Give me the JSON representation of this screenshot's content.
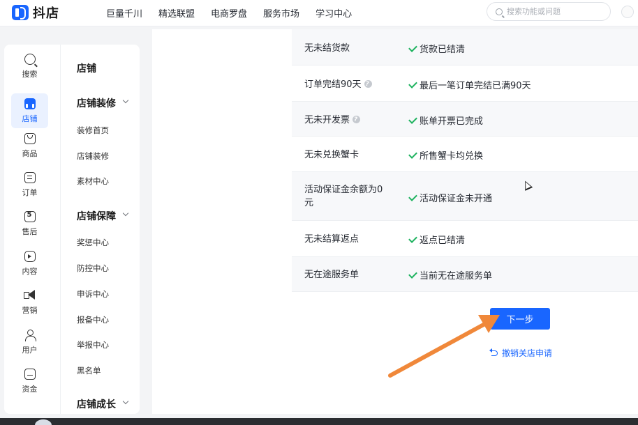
{
  "app": {
    "logo_text": "抖店",
    "brand_color": "#1966ff"
  },
  "topnav": [
    "巨量千川",
    "精选联盟",
    "电商罗盘",
    "服务市场",
    "学习中心"
  ],
  "search": {
    "placeholder": "搜索功能或问题"
  },
  "rail": [
    {
      "label": "搜索",
      "icon": "search-icon"
    },
    {
      "label": "店铺",
      "icon": "shop-icon",
      "active": true
    },
    {
      "label": "商品",
      "icon": "bag-icon"
    },
    {
      "label": "订单",
      "icon": "order-icon"
    },
    {
      "label": "售后",
      "icon": "after-sale-icon"
    },
    {
      "label": "内容",
      "icon": "content-icon"
    },
    {
      "label": "营销",
      "icon": "megaphone-icon"
    },
    {
      "label": "用户",
      "icon": "user-icon"
    },
    {
      "label": "资金",
      "icon": "wallet-icon"
    }
  ],
  "submenu": {
    "title": "店铺",
    "groups": [
      {
        "title": "店铺装修",
        "items": [
          "装修首页",
          "店铺装修",
          "素材中心"
        ]
      },
      {
        "title": "店铺保障",
        "items": [
          "奖惩中心",
          "防控中心",
          "申诉中心",
          "报备中心",
          "举报中心",
          "黑名单"
        ]
      },
      {
        "title": "店铺成长",
        "items": []
      }
    ]
  },
  "checks": [
    {
      "label": "无未结货款",
      "status": "货款已结清",
      "help": false
    },
    {
      "label": "订单完结90天",
      "status": "最后一笔订单完结已满90天",
      "help": true
    },
    {
      "label": "无未开发票",
      "status": "账单开票已完成",
      "help": true
    },
    {
      "label": "无未兑换蟹卡",
      "status": "所售蟹卡均兑换",
      "help": false
    },
    {
      "label_line1": "活动保证金余额为0",
      "label_line2": "元",
      "status": "活动保证金未开通",
      "help": false
    },
    {
      "label": "无未结算返点",
      "status": "返点已结清",
      "help": false
    },
    {
      "label": "无在途服务单",
      "status": "当前无在途服务单",
      "help": false
    }
  ],
  "actions": {
    "next_label": "下一步",
    "revoke_label": "撤销关店申请"
  },
  "annotation": {
    "arrow_color": "#f0883a"
  }
}
